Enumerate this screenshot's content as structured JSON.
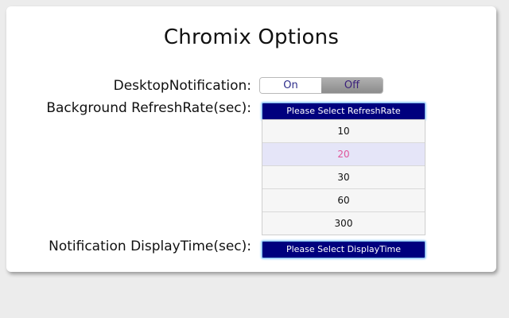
{
  "page": {
    "title": "Chromix Options"
  },
  "desktop_notification": {
    "label": "DesktopNotification:",
    "on_label": "On",
    "off_label": "Off",
    "selected": "Off"
  },
  "refresh_rate": {
    "label": "Background RefreshRate(sec):",
    "select_label": "Please Select RefreshRate",
    "options": [
      "10",
      "20",
      "30",
      "60",
      "300"
    ],
    "selected": "20"
  },
  "display_time": {
    "label": "Notification DisplayTime(sec):",
    "select_label": "Please Select DisplayTime"
  },
  "colors": {
    "button_bg": "#00007e",
    "selected_option_text": "#e0559a",
    "selected_option_bg": "#e5e5f8"
  }
}
